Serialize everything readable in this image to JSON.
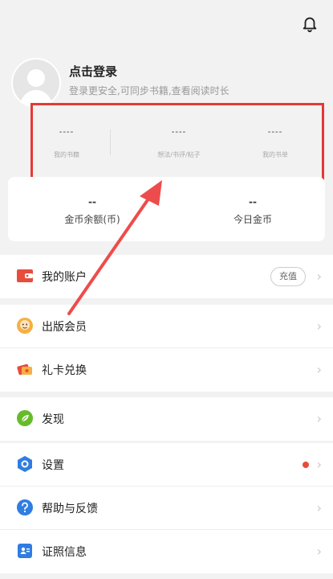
{
  "header": {
    "icons": [
      "bell-icon"
    ]
  },
  "profile": {
    "title": "点击登录",
    "subtitle": "登录更安全,可同步书籍,查看阅读时长"
  },
  "stats": [
    {
      "value": "----",
      "label": "我的书籍"
    },
    {
      "value": "----",
      "label": "想法/书评/帖子"
    },
    {
      "value": "----",
      "label": "我的书单"
    }
  ],
  "coins": [
    {
      "value": "--",
      "label": "金币余额(币)"
    },
    {
      "value": "--",
      "label": "今日金币"
    }
  ],
  "menu": {
    "account": {
      "label": "我的账户",
      "action": "充值"
    },
    "publish": {
      "label": "出版会员"
    },
    "giftcard": {
      "label": "礼卡兑换"
    },
    "discover": {
      "label": "发现"
    },
    "settings": {
      "label": "设置"
    },
    "help": {
      "label": "帮助与反馈"
    },
    "license": {
      "label": "证照信息"
    }
  },
  "colors": {
    "highlight": "#e53935",
    "accent_red": "#e74c3c",
    "green": "#66bb2a",
    "blue": "#2f7de1",
    "orange": "#f39c12"
  }
}
